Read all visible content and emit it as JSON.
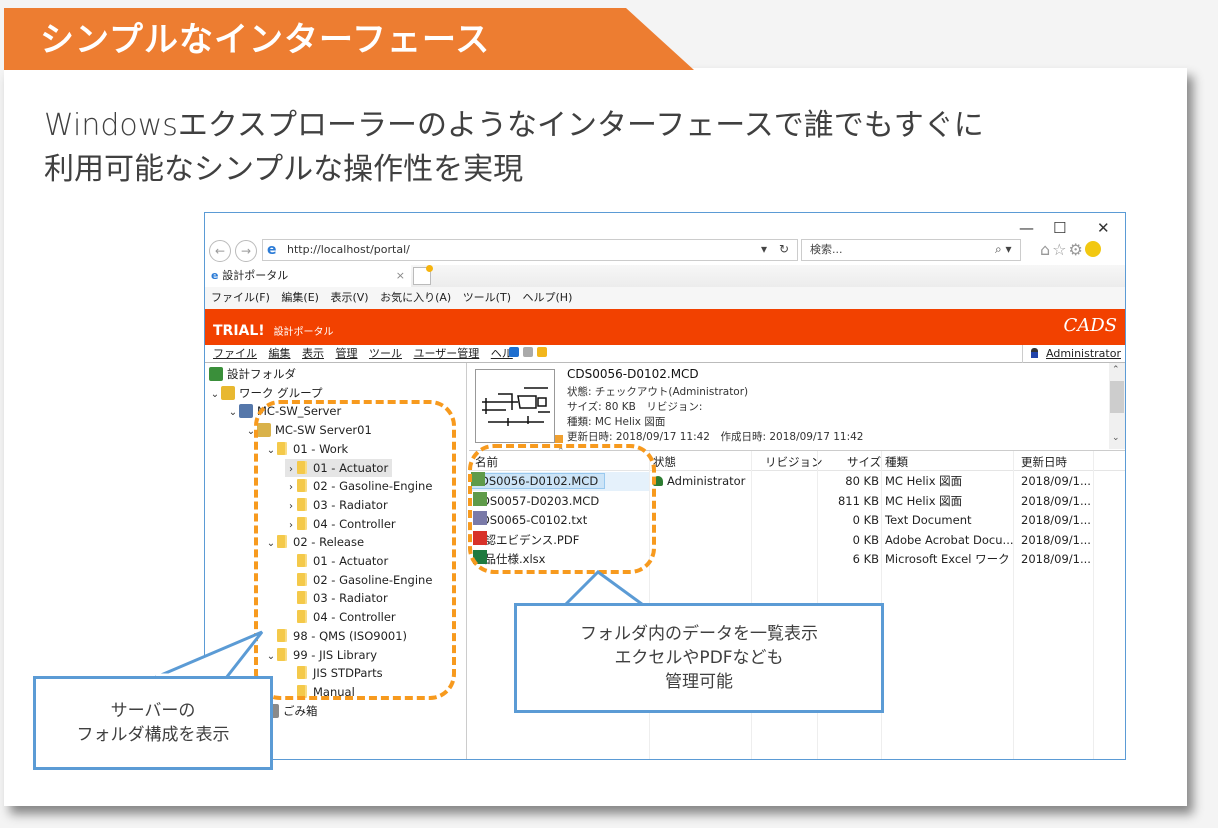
{
  "banner": {
    "title": "シンプルなインターフェース",
    "color": "#ED7D31"
  },
  "lead": {
    "line1": "Windowsエクスプローラーのようなインターフェースで誰でもすぐに",
    "line2": "利用可能なシンプルな操作性を実現"
  },
  "browser": {
    "window_controls": {
      "minimize": "—",
      "maximize": "☐",
      "close": "✕"
    },
    "back_icon": "back-arrow-icon",
    "forward_icon": "forward-arrow-icon",
    "address": "http://localhost/portal/",
    "address_dropdown": "▾",
    "refresh": "↻",
    "search_placeholder": "検索...",
    "search_icon": "⌕ ▾",
    "toolbar_icons": [
      "home-icon",
      "favorites-star-icon",
      "settings-gear-icon",
      "feedback-smiley-icon"
    ],
    "toolbar_glyphs": {
      "home": "⌂",
      "star": "☆",
      "gear": "⚙"
    },
    "tab": {
      "label": "設計ポータル",
      "close": "×"
    },
    "menu": [
      "ファイル(F)",
      "編集(E)",
      "表示(V)",
      "お気に入り(A)",
      "ツール(T)",
      "ヘルプ(H)"
    ]
  },
  "app": {
    "title": "TRIAL!",
    "subtitle": "設計ポータル",
    "logo": "CADS",
    "header_color": "#F24100",
    "menu": [
      "ファイル",
      "編集",
      "表示",
      "管理",
      "ツール",
      "ユーザー管理",
      "ヘル"
    ],
    "user": "Administrator"
  },
  "tree": [
    {
      "label": "設計フォルダ",
      "type": "root",
      "expander": ""
    },
    {
      "label": "ワーク グループ",
      "type": "group",
      "expander": "⌄"
    },
    {
      "label": "MC-SW_Server",
      "type": "server",
      "expander": "⌄"
    },
    {
      "label": "MC-SW Server01",
      "type": "share",
      "expander": "⌄"
    },
    {
      "label": "01 - Work",
      "type": "folder",
      "expander": "⌄"
    },
    {
      "label": "01 - Actuator",
      "type": "folder",
      "expander": "›",
      "selected": true
    },
    {
      "label": "02 - Gasoline-Engine",
      "type": "folder",
      "expander": "›"
    },
    {
      "label": "03 - Radiator",
      "type": "folder",
      "expander": "›"
    },
    {
      "label": "04 - Controller",
      "type": "folder",
      "expander": "›"
    },
    {
      "label": "02 - Release",
      "type": "folder",
      "expander": "⌄"
    },
    {
      "label": "01 - Actuator",
      "type": "folder",
      "expander": ""
    },
    {
      "label": "02 - Gasoline-Engine",
      "type": "folder",
      "expander": ""
    },
    {
      "label": "03 - Radiator",
      "type": "folder",
      "expander": ""
    },
    {
      "label": "04 - Controller",
      "type": "folder",
      "expander": ""
    },
    {
      "label": "98 - QMS (ISO9001)",
      "type": "folder",
      "expander": ""
    },
    {
      "label": "99 - JIS Library",
      "type": "folder",
      "expander": "⌄"
    },
    {
      "label": "JIS STDParts",
      "type": "folder",
      "expander": ""
    },
    {
      "label": "Manual",
      "type": "folder",
      "expander": ""
    },
    {
      "label": "ごみ箱",
      "type": "trash",
      "expander": ""
    }
  ],
  "detail": {
    "filename": "CDS0056-D0102.MCD",
    "status": "状態: チェックアウト(Administrator)",
    "size_rev": "サイズ: 80 KB　リビジョン:",
    "kind": "種類: MC Helix 図面",
    "dates": "更新日時: 2018/09/17 11:42　作成日時: 2018/09/17 11:42"
  },
  "file_list": {
    "columns": [
      "名前",
      "状態",
      "リビジョン",
      "サイズ",
      "種類",
      "更新日時"
    ],
    "rows": [
      {
        "name": "CDS0056-D0102.MCD",
        "icon": "mcd-file-icon",
        "status": "Administrator",
        "revision": "",
        "size": "80 KB",
        "kind": "MC Helix 図面",
        "modified": "2018/09/1...",
        "selected": true
      },
      {
        "name": "CDS0057-D0203.MCD",
        "icon": "mcd-file-icon",
        "status": "",
        "revision": "",
        "size": "811 KB",
        "kind": "MC Helix 図面",
        "modified": "2018/09/1..."
      },
      {
        "name": "ZDS0065-C0102.txt",
        "icon": "text-file-icon",
        "status": "",
        "revision": "",
        "size": "0 KB",
        "kind": "Text Document",
        "modified": "2018/09/1..."
      },
      {
        "name": "承認エビデンス.PDF",
        "icon": "pdf-file-icon",
        "status": "",
        "revision": "",
        "size": "0 KB",
        "kind": "Adobe Acrobat Docu...",
        "modified": "2018/09/1..."
      },
      {
        "name": "製品仕様.xlsx",
        "icon": "excel-file-icon",
        "status": "",
        "revision": "",
        "size": "6 KB",
        "kind": "Microsoft Excel ワーク",
        "modified": "2018/09/1..."
      }
    ]
  },
  "callouts": {
    "list": {
      "line1": "フォルダ内のデータを一覧表示",
      "line2": "エクセルやPDFなども",
      "line3": "管理可能"
    },
    "tree": {
      "line1": "サーバーの",
      "line2": "フォルダ構成を表示"
    }
  },
  "colors": {
    "highlight_dash": "#F79A1E",
    "callout_border": "#5B9BD5"
  }
}
